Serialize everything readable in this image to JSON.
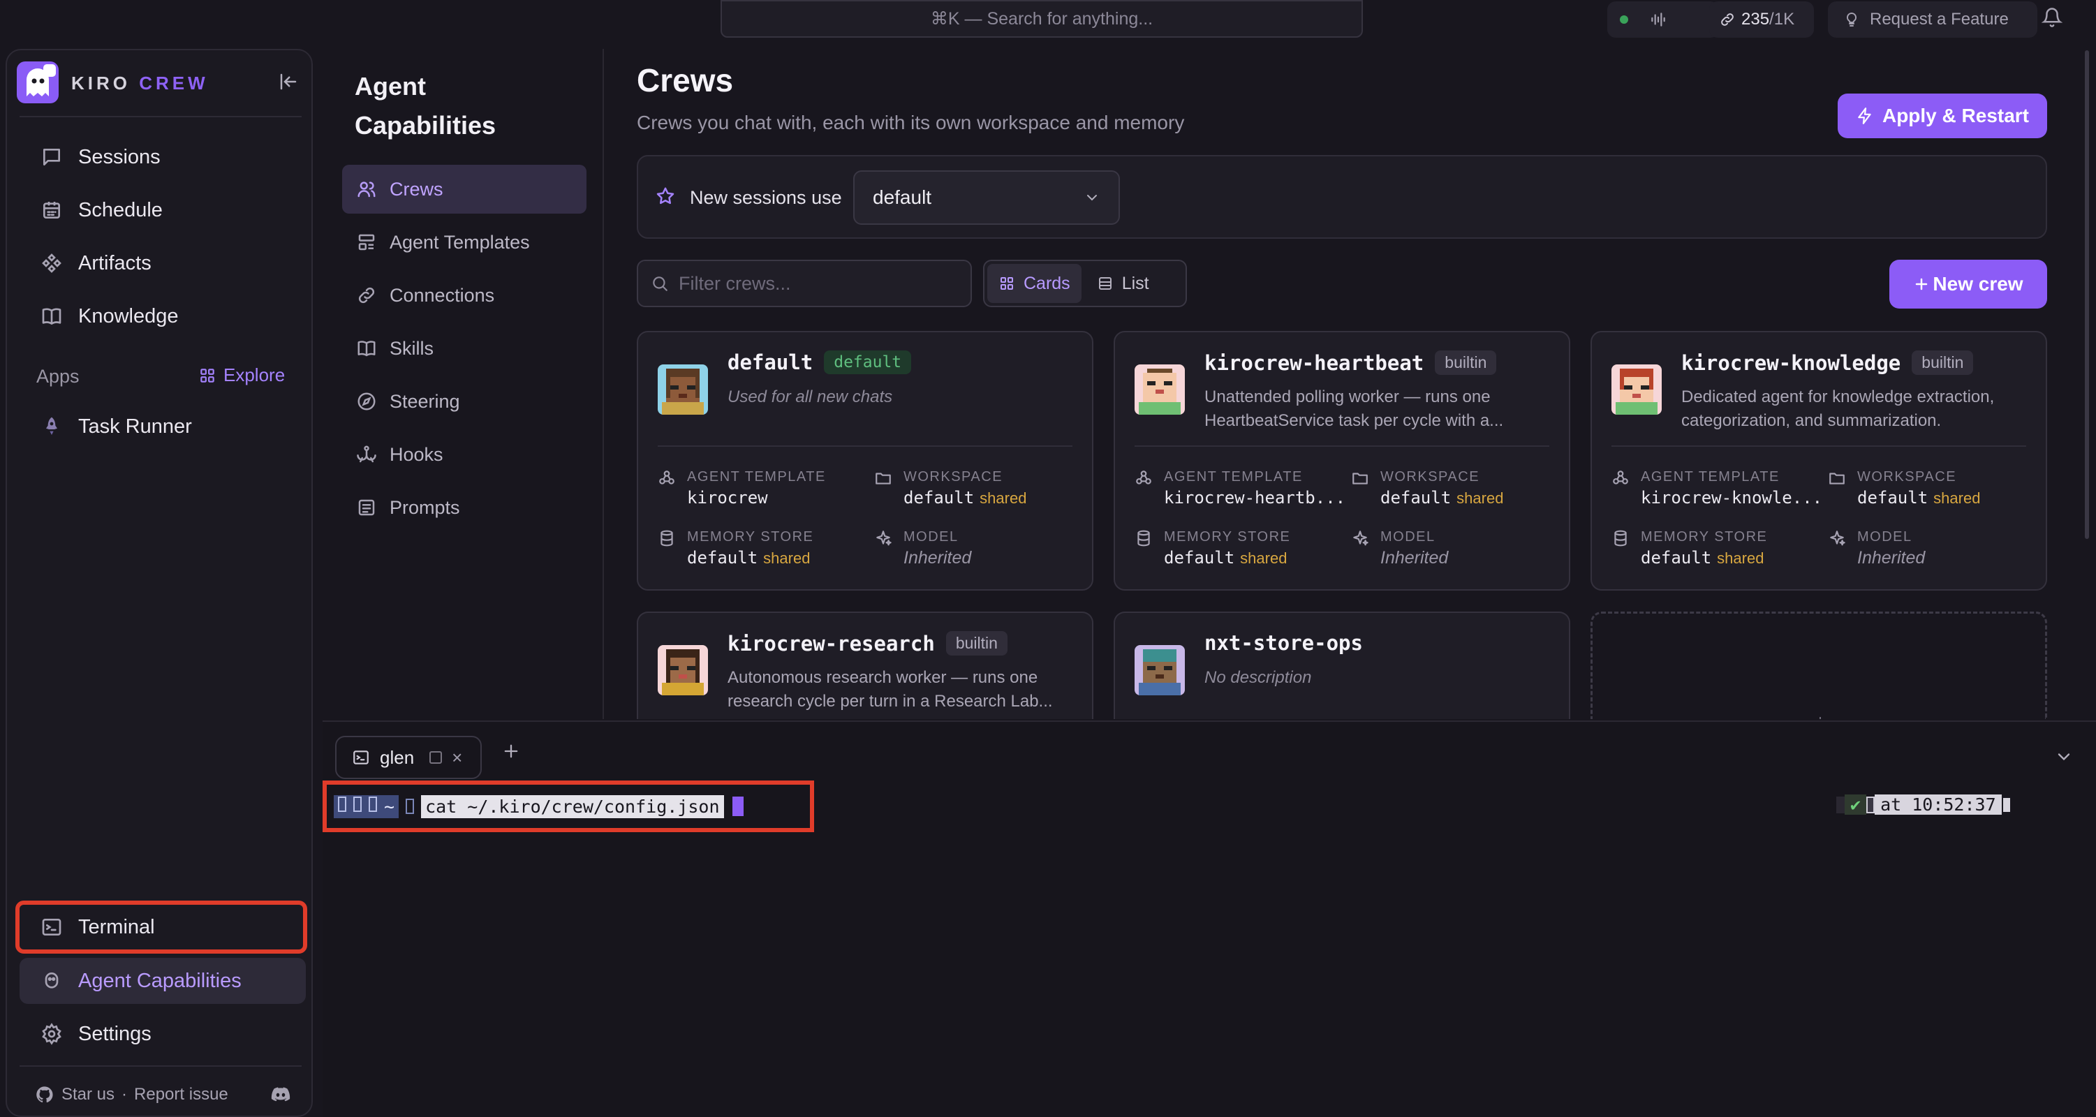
{
  "topbar": {
    "search_placeholder": "⌘K — Search for anything...",
    "link_count": "235",
    "link_total": "/1K",
    "request_feature": "Request a Feature"
  },
  "sidebar": {
    "brand_first": "KIRO",
    "brand_second": "CREW",
    "nav": [
      {
        "label": "Sessions",
        "icon": "chat-icon"
      },
      {
        "label": "Schedule",
        "icon": "calendar-icon"
      },
      {
        "label": "Artifacts",
        "icon": "artifacts-icon"
      },
      {
        "label": "Knowledge",
        "icon": "book-icon"
      }
    ],
    "apps_label": "Apps",
    "explore_label": "Explore",
    "task_runner": "Task Runner",
    "terminal": "Terminal",
    "agent_capabilities": "Agent Capabilities",
    "settings": "Settings",
    "star_us": "Star us",
    "separator": "·",
    "report_issue": "Report issue"
  },
  "capabilities": {
    "title_line1": "Agent",
    "title_line2": "Capabilities",
    "items": [
      "Crews",
      "Agent Templates",
      "Connections",
      "Skills",
      "Steering",
      "Hooks",
      "Prompts"
    ]
  },
  "main": {
    "title": "Crews",
    "subtitle": "Crews you chat with, each with its own workspace and memory",
    "apply_restart": "Apply & Restart",
    "new_sessions_use": "New sessions use",
    "default_select": "default",
    "filter_placeholder": "Filter crews...",
    "view_cards": "Cards",
    "view_list": "List",
    "new_crew": "New crew",
    "labels": {
      "agent_template": "AGENT TEMPLATE",
      "workspace": "WORKSPACE",
      "memory_store": "MEMORY STORE",
      "model": "MODEL",
      "shared": "shared"
    },
    "crews": [
      {
        "name": "default",
        "badge": "default",
        "description": "Used for all new chats",
        "agent_template": "kirocrew",
        "workspace": "default",
        "memory_store": "default",
        "model": "Inherited"
      },
      {
        "name": "kirocrew-heartbeat",
        "badge": "builtin",
        "description": "Unattended polling worker — runs one HeartbeatService task per cycle with a...",
        "agent_template": "kirocrew-heartb...",
        "workspace": "default",
        "memory_store": "default",
        "model": "Inherited"
      },
      {
        "name": "kirocrew-knowledge",
        "badge": "builtin",
        "description": "Dedicated agent for knowledge extraction, categorization, and summarization.",
        "agent_template": "kirocrew-knowle...",
        "workspace": "default",
        "memory_store": "default",
        "model": "Inherited"
      },
      {
        "name": "kirocrew-research",
        "badge": "builtin",
        "description": "Autonomous research worker — runs one research cycle per turn in a Research Lab..."
      },
      {
        "name": "nxt-store-ops",
        "description": "No description"
      }
    ]
  },
  "terminal": {
    "tab_label": "glen",
    "prompt_path": "~",
    "command": "cat ~/.kiro/crew/config.json",
    "right_check": "✔",
    "right_time": "at 10:52:37"
  }
}
